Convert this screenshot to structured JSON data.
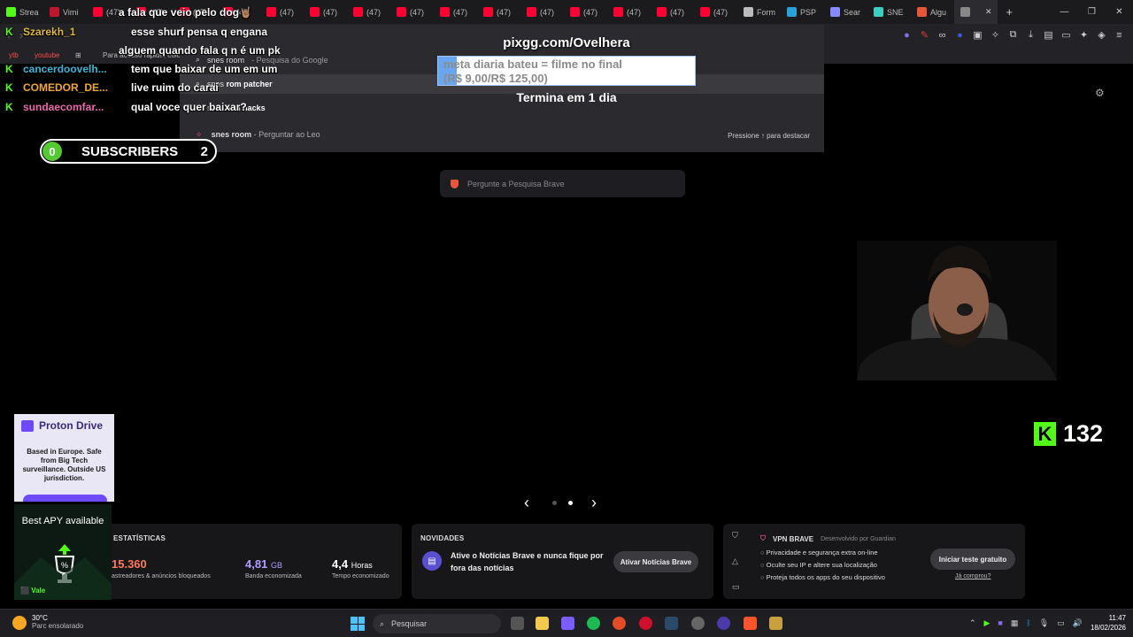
{
  "browser": {
    "tabs": [
      {
        "label": "Strea",
        "color": "#53fc18"
      },
      {
        "label": "Vimi",
        "color": "#c0162d"
      },
      {
        "label": "(47)",
        "color": "#ff0033"
      },
      {
        "label": "(47)",
        "color": "#ff0033"
      },
      {
        "label": "(47)",
        "color": "#ff0033"
      },
      {
        "label": "(47)",
        "color": "#ff0033"
      },
      {
        "label": "(47)",
        "color": "#ff0033"
      },
      {
        "label": "(47)",
        "color": "#ff0033"
      },
      {
        "label": "(47)",
        "color": "#ff0033"
      },
      {
        "label": "(47)",
        "color": "#ff0033"
      },
      {
        "label": "(47)",
        "color": "#ff0033"
      },
      {
        "label": "(47)",
        "color": "#ff0033"
      },
      {
        "label": "(47)",
        "color": "#ff0033"
      },
      {
        "label": "(47)",
        "color": "#ff0033"
      },
      {
        "label": "(47)",
        "color": "#ff0033"
      },
      {
        "label": "(47)",
        "color": "#ff0033"
      },
      {
        "label": "(47)",
        "color": "#ff0033"
      },
      {
        "label": "Form",
        "color": "#bbbbbb"
      },
      {
        "label": "PSP",
        "color": "#2aa0d8"
      },
      {
        "label": "Sear",
        "color": "#8a8aff"
      },
      {
        "label": "SNE",
        "color": "#3ad0c0"
      },
      {
        "label": "Algu",
        "color": "#e8563a"
      },
      {
        "label": "",
        "color": "#888888"
      }
    ],
    "new_tab_symbol": "+",
    "window_controls": [
      "—",
      "❐",
      "✕"
    ]
  },
  "bookmarks": {
    "items": [
      "ytb",
      "youtube",
      "Para acesso rápido, colo"
    ]
  },
  "omnibox": {
    "rows": [
      {
        "prefix": "snes room",
        "suffix": "- Pesquisa do Google",
        "bold": ""
      },
      {
        "prefix": "snes",
        "suffix": "",
        "bold": "rom patcher"
      },
      {
        "prefix": "snes ro",
        "suffix": "",
        "bold": "m hacks"
      }
    ],
    "footer_query": "snes room",
    "footer_action": "- Perguntar ao Leo",
    "hint": "Pressione ↑ para destacar"
  },
  "chat": [
    {
      "user": "",
      "message": "a fala que veio pelo dog🤘🏽"
    },
    {
      "user": "Szarekh_1",
      "message": "esse shurf pensa q engana"
    },
    {
      "user": "",
      "message": "alguem quando fala q n é um pk"
    },
    {
      "user": "cancerdoovelh...",
      "message": "tem que baixar de um em um"
    },
    {
      "user": "COMEDOR_DE...",
      "message": "live ruim do carai"
    },
    {
      "user": "sundaecomfar...",
      "message": "qual voce quer baixar?"
    }
  ],
  "chat_user_colors": [
    "#ffffff",
    "#e0b83a",
    "#ffffff",
    "#3ab6d8",
    "#f0a830",
    "#e86aa8"
  ],
  "subscribers": {
    "current": "0",
    "label": "SUBSCRIBERS",
    "goal": "2"
  },
  "donation": {
    "url": "pixgg.com/Ovelhera",
    "goal_line1": "meta diaria bateu = filme no final",
    "goal_line2": "(R$ 9,00/R$ 125,00)",
    "progress_fraction": 0.072,
    "ends": "Termina em 1 dia"
  },
  "kick_viewers": {
    "logo": "K",
    "count": "132"
  },
  "search": {
    "placeholder": "Pergunte a Pesquisa Brave"
  },
  "carousel": {
    "prev": "‹",
    "next": "›",
    "active_index": 1,
    "count": 2
  },
  "stats": {
    "title": "ESTATÍSTICAS",
    "trackers_value": "15.360",
    "trackers_label": "astreadores & anúncios bloqueados",
    "bandwidth_value": "4,81",
    "bandwidth_unit": "GB",
    "bandwidth_label": "Banda economizada",
    "time_value": "4,4",
    "time_unit": "Horas",
    "time_label": "Tempo economizado"
  },
  "news": {
    "title": "NOVIDADES",
    "text": "Ative o Notícias Brave e nunca fique por fora das notícias",
    "button": "Ativar Notícias Brave"
  },
  "vpn": {
    "title": "VPN BRAVE",
    "by": "Desenvolvido por  Guardian",
    "features": [
      "Privacidade e segurança extra on-line",
      "Oculte seu IP e altere sua localização",
      "Proteja todos os apps do seu dispositivo"
    ],
    "button": "Iniciar teste gratuito",
    "link": "Já comprou?"
  },
  "ads": {
    "proton_brand": "Proton Drive",
    "proton_text": "Based in Europe. Safe from Big Tech surveillance. Outside US jurisdiction.",
    "apy_text": "Best APY available",
    "apy_brand": "Vale"
  },
  "taskbar": {
    "temperature": "30°C",
    "weather": "Parc ensolarado",
    "search": "Pesquisar",
    "time": "11:47",
    "date": "18/02/2026"
  }
}
